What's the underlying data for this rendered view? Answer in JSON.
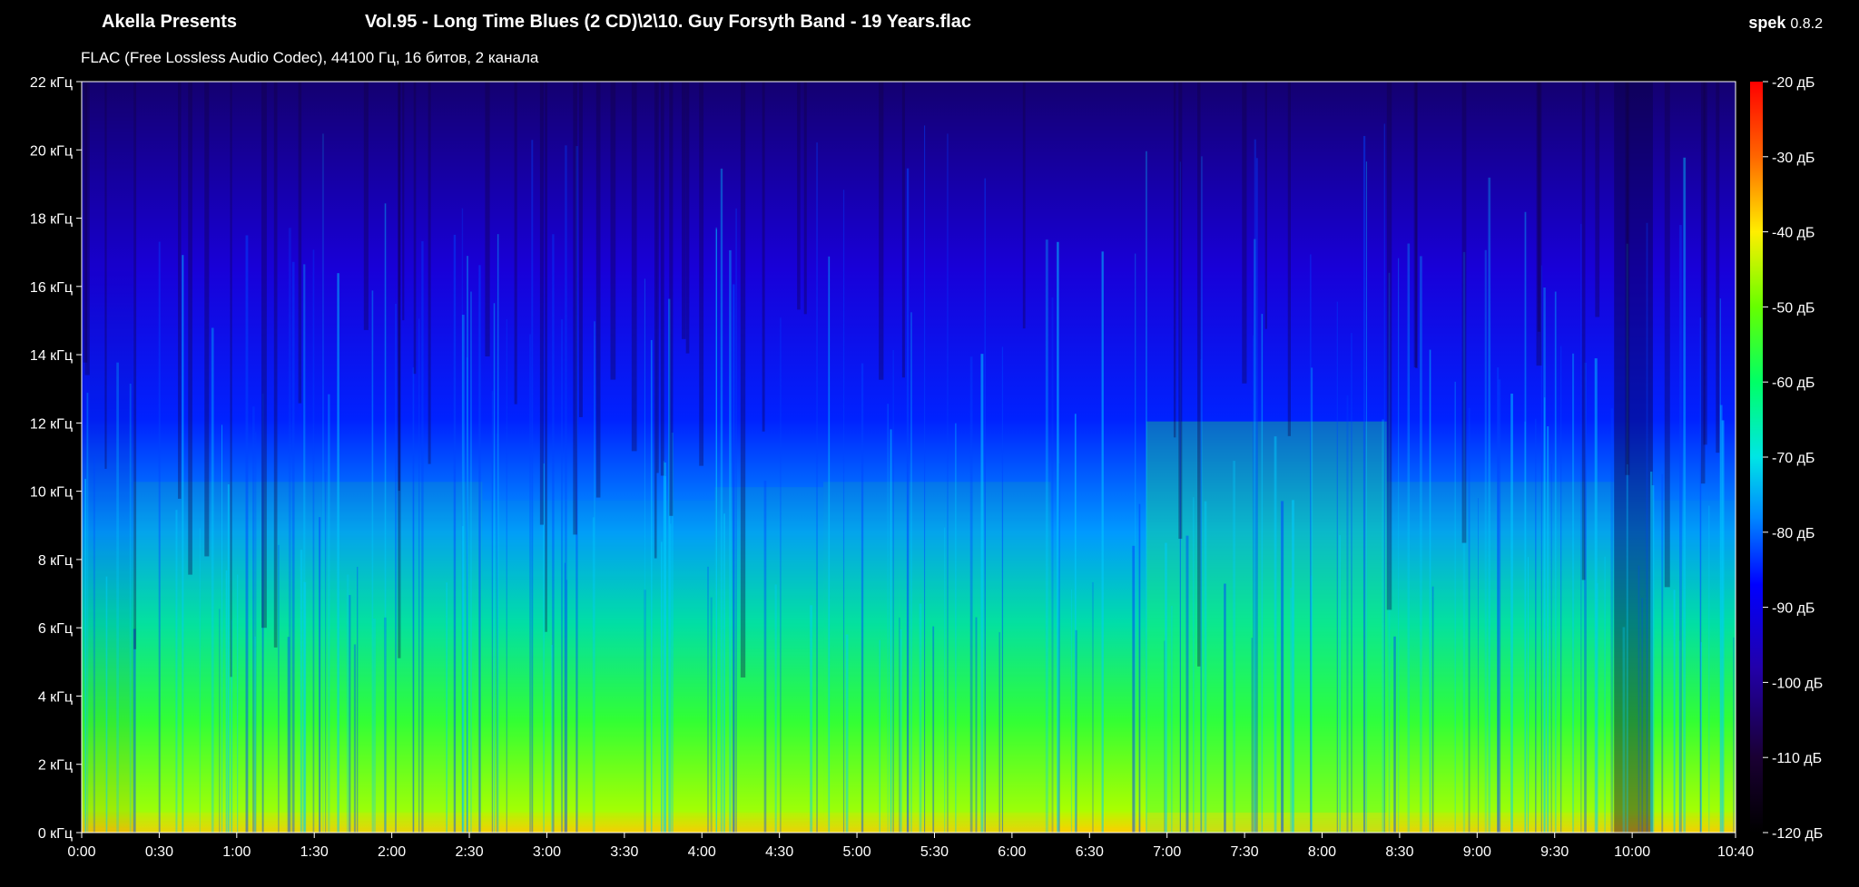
{
  "header": {
    "artist": "Akella Presents",
    "title": "Vol.95 - Long Time Blues (2 CD)\\2\\10. Guy Forsyth Band - 19 Years.flac",
    "app_name": "spek",
    "app_version": "0.8.2",
    "format_info": "FLAC (Free Lossless Audio Codec), 44100 Гц, 16 битов, 2 канала"
  },
  "colors": {
    "background": "#000000",
    "text": "#ffffff",
    "scale": [
      "#000000",
      "#1a0033",
      "#2200aa",
      "#0000ff",
      "#0088ff",
      "#00e5e5",
      "#00ff66",
      "#66ff00",
      "#ffee00",
      "#ff6600",
      "#ff0000"
    ]
  },
  "chart_data": {
    "type": "heatmap",
    "x_ticks": [
      "0:00",
      "0:30",
      "1:00",
      "1:30",
      "2:00",
      "2:30",
      "3:00",
      "3:30",
      "4:00",
      "4:30",
      "5:00",
      "5:30",
      "6:00",
      "6:30",
      "7:00",
      "7:30",
      "8:00",
      "8:30",
      "9:00",
      "9:30",
      "10:00",
      "10:40"
    ],
    "x_tick_seconds": [
      0,
      30,
      60,
      90,
      120,
      150,
      180,
      210,
      240,
      270,
      300,
      330,
      360,
      390,
      420,
      450,
      480,
      510,
      540,
      570,
      600,
      640
    ],
    "x_range_seconds": [
      0,
      640
    ],
    "y_ticks": [
      "0 кГц",
      "2 кГц",
      "4 кГц",
      "6 кГц",
      "8 кГц",
      "10 кГц",
      "12 кГц",
      "14 кГц",
      "16 кГц",
      "18 кГц",
      "20 кГц",
      "22 кГц"
    ],
    "y_tick_khz": [
      0,
      2,
      4,
      6,
      8,
      10,
      12,
      14,
      16,
      18,
      20,
      22
    ],
    "y_range_khz": [
      0,
      22
    ],
    "colorbar_ticks": [
      "-20 дБ",
      "-30 дБ",
      "-40 дБ",
      "-50 дБ",
      "-60 дБ",
      "-70 дБ",
      "-80 дБ",
      "-90 дБ",
      "-100 дБ",
      "-110 дБ",
      "-120 дБ"
    ],
    "colorbar_db": [
      -20,
      -30,
      -40,
      -50,
      -60,
      -70,
      -80,
      -90,
      -100,
      -110,
      -120
    ],
    "colorbar_range_db": [
      -120,
      -20
    ],
    "segments": [
      {
        "start": 0,
        "end": 20,
        "level": 0.45
      },
      {
        "start": 20,
        "end": 155,
        "level": 0.62
      },
      {
        "start": 155,
        "end": 245,
        "level": 0.55
      },
      {
        "start": 245,
        "end": 287,
        "level": 0.6
      },
      {
        "start": 287,
        "end": 375,
        "level": 0.62
      },
      {
        "start": 375,
        "end": 412,
        "level": 0.5
      },
      {
        "start": 412,
        "end": 505,
        "level": 0.85
      },
      {
        "start": 505,
        "end": 593,
        "level": 0.62
      },
      {
        "start": 593,
        "end": 608,
        "level": 0.2
      },
      {
        "start": 608,
        "end": 640,
        "level": 0.55
      }
    ]
  }
}
